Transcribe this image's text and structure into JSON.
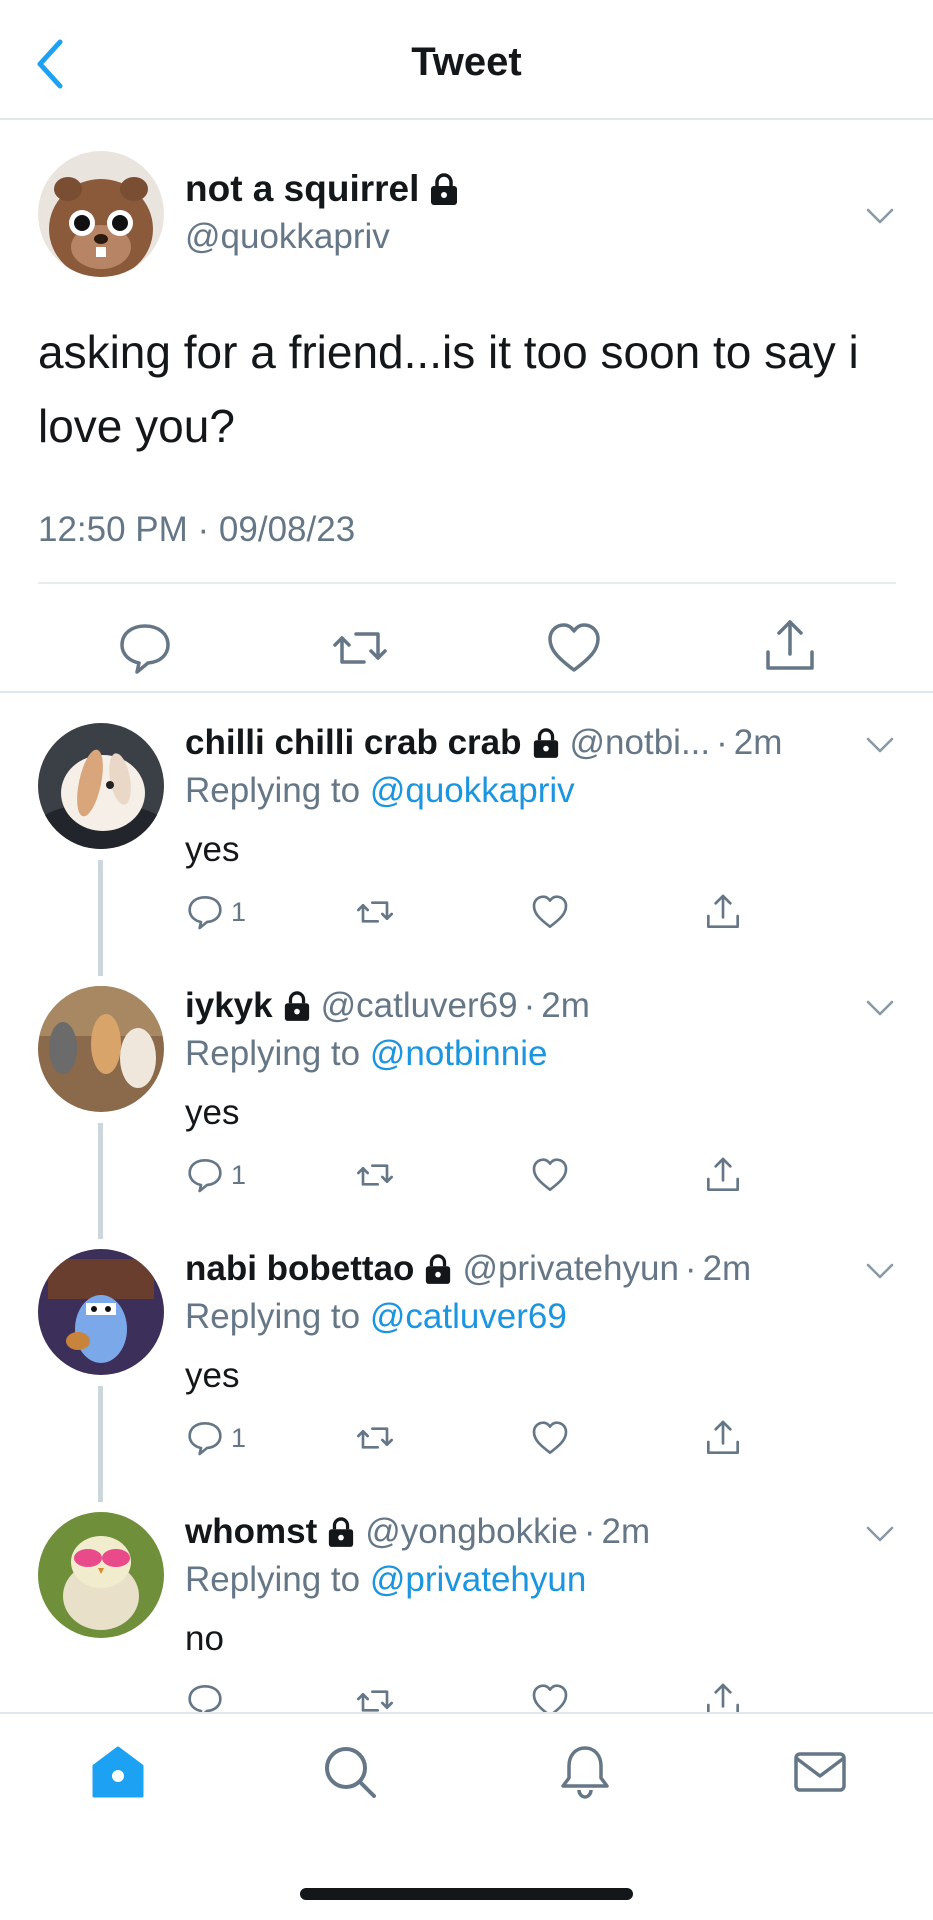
{
  "header": {
    "title": "Tweet"
  },
  "main_tweet": {
    "name": "not a squirrel",
    "handle": "@quokkapriv",
    "text": "asking for a friend...is it too soon to say i love you?",
    "timestamp": "12:50 PM · 09/08/23"
  },
  "replies": [
    {
      "name": "chilli chilli crab crab",
      "handle": "@notbi...",
      "dot": "·",
      "time": "2m",
      "replying_prefix": "Replying to",
      "replying_to": "@quokkapriv",
      "text": "yes",
      "reply_count": "1"
    },
    {
      "name": "iykyk",
      "handle": "@catluver69",
      "dot": "·",
      "time": "2m",
      "replying_prefix": "Replying to",
      "replying_to": "@notbinnie",
      "text": "yes",
      "reply_count": "1"
    },
    {
      "name": "nabi bobettao",
      "handle": "@privatehyun",
      "dot": "·",
      "time": "2m",
      "replying_prefix": "Replying to",
      "replying_to": "@catluver69",
      "text": "yes",
      "reply_count": "1"
    },
    {
      "name": "whomst",
      "handle": "@yongbokkie",
      "dot": "·",
      "time": "2m",
      "replying_prefix": "Replying to",
      "replying_to": "@privatehyun",
      "text": "no",
      "reply_count": ""
    }
  ],
  "colors": {
    "accent": "#1da1f2",
    "link": "#1b95e0",
    "muted": "#657786",
    "text": "#14171a",
    "divider": "#e1e8ed"
  },
  "icons": [
    "back-chevron-icon",
    "lock-icon",
    "chevron-down-icon",
    "reply-icon",
    "retweet-icon",
    "like-icon",
    "share-icon",
    "home-icon",
    "search-icon",
    "notifications-icon",
    "messages-icon"
  ]
}
